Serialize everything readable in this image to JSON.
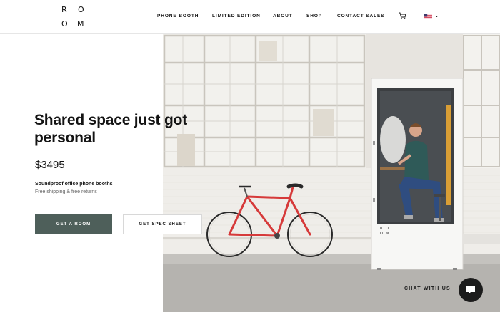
{
  "logo": {
    "letters": [
      "R",
      "O",
      "O",
      "M"
    ]
  },
  "nav": {
    "items": [
      "PHONE BOOTH",
      "LIMITED EDITION",
      "ABOUT",
      "SHOP",
      "CONTACT SALES"
    ]
  },
  "header_icons": {
    "cart": "cart-icon",
    "locale": "us-flag-icon",
    "dropdown": "chevron-down-icon"
  },
  "hero": {
    "headline": "Shared space just got personal",
    "price": "$3495",
    "subtitle": "Soundproof office phone booths",
    "shipping": "Free shipping & free returns",
    "primary_button": "GET A ROOM",
    "secondary_button": "GET SPEC SHEET",
    "booth_logo": [
      "R",
      "O",
      "O",
      "M"
    ]
  },
  "chat": {
    "label": "CHAT WITH US",
    "icon": "chat-bubble-icon"
  },
  "colors": {
    "primary_button": "#4e5f5a",
    "bike_red": "#d63a3a",
    "chat_button": "#1c1c1c"
  }
}
